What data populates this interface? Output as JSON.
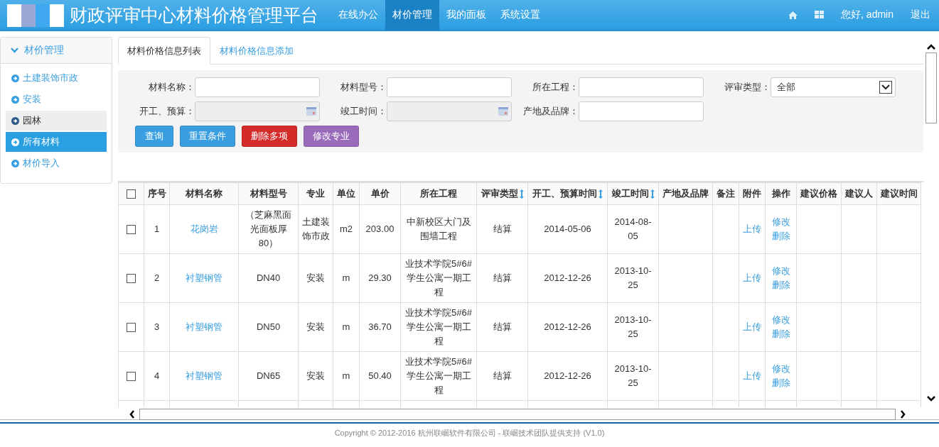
{
  "header": {
    "title": "财政评审中心材料价格管理平台",
    "nav": [
      {
        "label": "在线办公",
        "selected": false
      },
      {
        "label": "材价管理",
        "selected": true
      },
      {
        "label": "我的面板",
        "selected": false
      },
      {
        "label": "系统设置",
        "selected": false
      }
    ],
    "greeting": "您好, admin",
    "logout": "退出"
  },
  "sidebar": {
    "title": "材价管理",
    "items": [
      {
        "label": "土建装饰市政",
        "selected": false,
        "hovered": false
      },
      {
        "label": "安装",
        "selected": false,
        "hovered": false
      },
      {
        "label": "园林",
        "selected": false,
        "hovered": true
      },
      {
        "label": "所有材料",
        "selected": true,
        "hovered": false
      },
      {
        "label": "材价导入",
        "selected": false,
        "hovered": false
      }
    ]
  },
  "tabs": [
    {
      "label": "材料价格信息列表",
      "selected": true
    },
    {
      "label": "材料价格信息添加",
      "selected": false
    }
  ],
  "filters": {
    "fields": [
      {
        "label": "材料名称：",
        "kind": "text"
      },
      {
        "label": "材料型号：",
        "kind": "text"
      },
      {
        "label": "所在工程：",
        "kind": "text"
      },
      {
        "label": "评审类型：",
        "kind": "select",
        "value": "全部"
      },
      {
        "label": "开工、预算：",
        "kind": "date"
      },
      {
        "label": "竣工时间：",
        "kind": "date"
      },
      {
        "label": "产地及品牌：",
        "kind": "text"
      }
    ],
    "buttons": [
      {
        "label": "查询",
        "color": "#3a9fe0"
      },
      {
        "label": "重置条件",
        "color": "#3a9fe0"
      },
      {
        "label": "删除多项",
        "color": "#d42a2a"
      },
      {
        "label": "修改专业",
        "color": "#9b6bbb"
      }
    ]
  },
  "table": {
    "select_all_checked": false,
    "columns": [
      {
        "label": "序号",
        "sortable": false
      },
      {
        "label": "材料名称",
        "sortable": false
      },
      {
        "label": "材料型号",
        "sortable": false
      },
      {
        "label": "专业",
        "sortable": false
      },
      {
        "label": "单位",
        "sortable": false
      },
      {
        "label": "单价",
        "sortable": false
      },
      {
        "label": "所在工程",
        "sortable": false
      },
      {
        "label": "评审类型",
        "sortable": true
      },
      {
        "label": "开工、预算时间",
        "sortable": true
      },
      {
        "label": "竣工时间",
        "sortable": true
      },
      {
        "label": "产地及品牌",
        "sortable": false
      },
      {
        "label": "备注",
        "sortable": false
      },
      {
        "label": "附件",
        "sortable": false
      },
      {
        "label": "操作",
        "sortable": false
      },
      {
        "label": "建议价格",
        "sortable": false
      },
      {
        "label": "建议人",
        "sortable": false
      },
      {
        "label": "建议时间",
        "sortable": false
      }
    ],
    "rows": [
      {
        "checked": false,
        "index": "1",
        "name": "花岗岩",
        "model": "（芝麻黑面光面板厚80）",
        "specialty": "土建装饰市政",
        "unit": "m2",
        "price": "203.00",
        "project": "中新校区大门及围墙工程",
        "review_type": "结算",
        "start_date": "2014-05-06",
        "end_date": "2014-08-05",
        "attachment": "上传",
        "edit": "修改",
        "delete": "删除"
      },
      {
        "checked": false,
        "index": "2",
        "name": "衬塑钢管",
        "model": "DN40",
        "specialty": "安装",
        "unit": "m",
        "price": "29.30",
        "project": "业技术学院5#6#学生公寓一期工程",
        "review_type": "结算",
        "start_date": "2012-12-26",
        "end_date": "2013-10-25",
        "attachment": "上传",
        "edit": "修改",
        "delete": "删除"
      },
      {
        "checked": false,
        "index": "3",
        "name": "衬塑钢管",
        "model": "DN50",
        "specialty": "安装",
        "unit": "m",
        "price": "36.70",
        "project": "业技术学院5#6#学生公寓一期工程",
        "review_type": "结算",
        "start_date": "2012-12-26",
        "end_date": "2013-10-25",
        "attachment": "上传",
        "edit": "修改",
        "delete": "删除"
      },
      {
        "checked": false,
        "index": "4",
        "name": "衬塑钢管",
        "model": "DN65",
        "specialty": "安装",
        "unit": "m",
        "price": "50.40",
        "project": "业技术学院5#6#学生公寓一期工程",
        "review_type": "结算",
        "start_date": "2012-12-26",
        "end_date": "2013-10-25",
        "attachment": "上传",
        "edit": "修改",
        "delete": "删除"
      }
    ]
  },
  "footer": "Copyright © 2012-2016 杭州联崛软件有限公司 - 联崛技术团队提供支持 (V1.0)"
}
